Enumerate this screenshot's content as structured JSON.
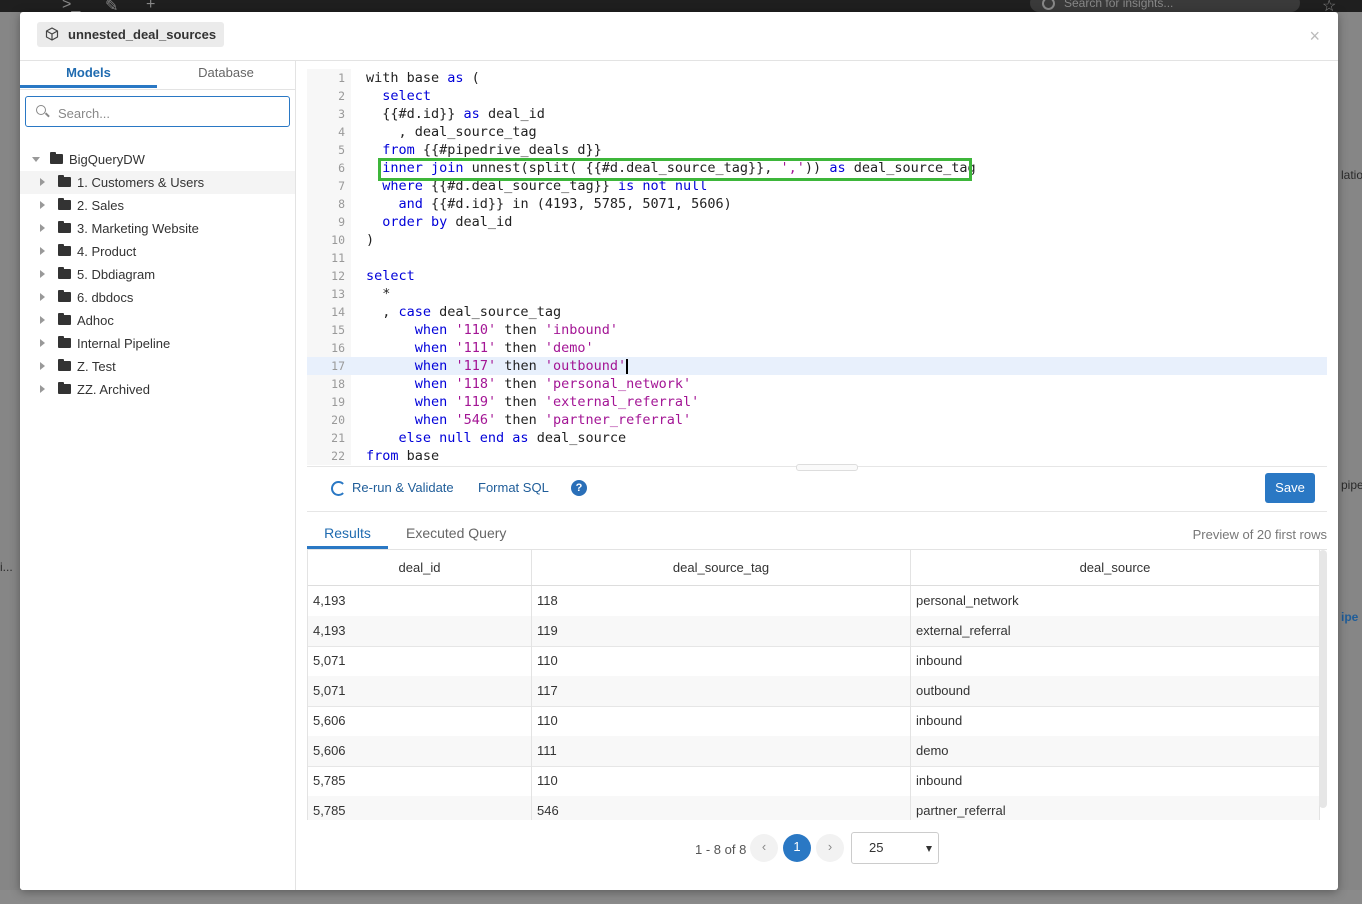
{
  "background": {
    "search_placeholder": "Search for insights...",
    "right_labels": [
      "latio",
      "pipe",
      "ipe"
    ],
    "left_label": "i..."
  },
  "modal": {
    "title": "unnested_deal_sources",
    "close_label": "×"
  },
  "sidebar": {
    "tabs": [
      "Models",
      "Database"
    ],
    "search_placeholder": "Search...",
    "root": "BigQueryDW",
    "folders": [
      "1. Customers & Users",
      "2. Sales",
      "3. Marketing Website",
      "4. Product",
      "5. Dbdiagram",
      "6. dbdocs",
      "Adhoc",
      "Internal Pipeline",
      "Z. Test",
      "ZZ. Archived"
    ]
  },
  "editor": {
    "line_numbers": [
      "1",
      "2",
      "3",
      "4",
      "5",
      "6",
      "7",
      "8",
      "9",
      "10",
      "11",
      "12",
      "13",
      "14",
      "15",
      "16",
      "17",
      "18",
      "19",
      "20",
      "21",
      "22"
    ]
  },
  "toolbar": {
    "rerun": "Re-run & Validate",
    "format": "Format SQL",
    "help": "?",
    "save": "Save"
  },
  "results": {
    "tabs": [
      "Results",
      "Executed Query"
    ],
    "preview_note": "Preview of 20 first rows",
    "columns": [
      "deal_id",
      "deal_source_tag",
      "deal_source"
    ],
    "rows": [
      [
        "4,193",
        "118",
        "personal_network"
      ],
      [
        "4,193",
        "119",
        "external_referral"
      ],
      [
        "5,071",
        "110",
        "inbound"
      ],
      [
        "5,071",
        "117",
        "outbound"
      ],
      [
        "5,606",
        "110",
        "inbound"
      ],
      [
        "5,606",
        "111",
        "demo"
      ],
      [
        "5,785",
        "110",
        "inbound"
      ],
      [
        "5,785",
        "546",
        "partner_referral"
      ]
    ]
  },
  "pagination": {
    "range_label": "1 - 8 of 8",
    "prev": "‹",
    "current_page": "1",
    "next": "›",
    "page_size": "25"
  },
  "colors": {
    "accent": "#2a78c4",
    "highlight_box": "#3db63a",
    "keyword": "#0000d9",
    "string": "#a31595"
  }
}
